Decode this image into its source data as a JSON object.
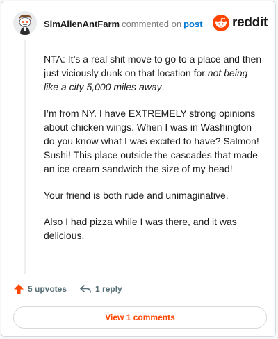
{
  "comment": {
    "author": "SimAlienAntFarm",
    "action": "commented on",
    "target_link": "post",
    "paragraphs": [
      {
        "before": "NTA: It’s a real shit move to go to a place and then just viciously dunk on that location for ",
        "italic": "not being like a city 5,000 miles away",
        "after": "."
      },
      {
        "text": "I’m from NY. I have EXTREMELY strong opinions about chicken wings. When I was in Washington do you know what I was excited to have? Salmon! Sushi! This place outside the cascades that made an ice cream sandwich the size of my head!"
      },
      {
        "text": "Your friend is both rude and unimaginative."
      },
      {
        "text": "Also I had pizza while I was there, and it was delicious."
      }
    ]
  },
  "brand": {
    "wordmark": "reddit",
    "icon": "reddit-snoo-logo",
    "color": "#ff4500"
  },
  "footer": {
    "upvotes_label": "5 upvotes",
    "upvote_icon": "upvote-arrow-icon",
    "upvote_color": "#ff4500",
    "reply_label": "1 reply",
    "reply_icon": "reply-arrow-icon"
  },
  "view_comments": {
    "label": "View 1 comments"
  }
}
